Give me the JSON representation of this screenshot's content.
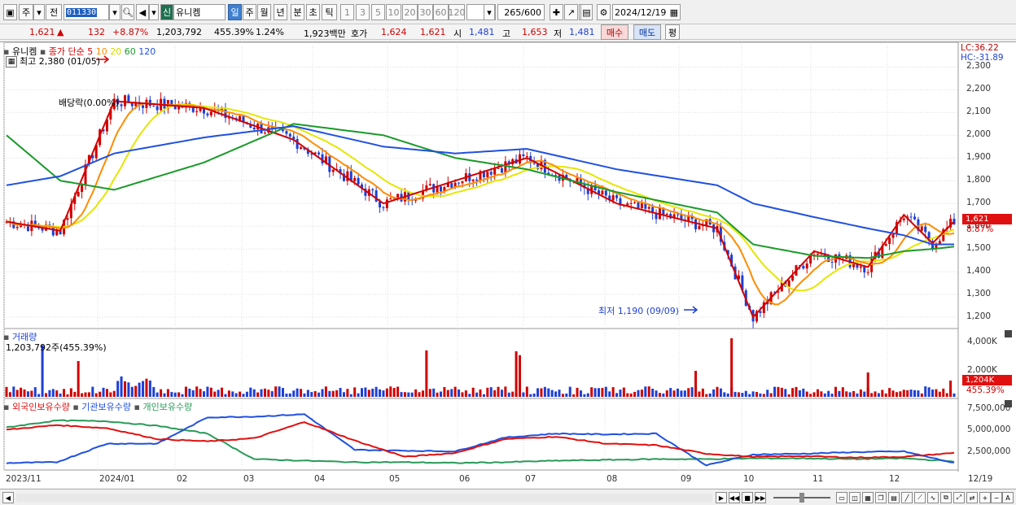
{
  "toolbar": {
    "period_type": "주",
    "prev_label": "전",
    "code": "011330",
    "market_tag": "신",
    "name": "유니켐",
    "periods": [
      "일",
      "주",
      "월",
      "년",
      "분",
      "초",
      "틱"
    ],
    "selected_period": "일",
    "intervals": [
      "1",
      "3",
      "5",
      "10",
      "20",
      "30",
      "60",
      "120"
    ],
    "count_value": "265",
    "count_max": "/600",
    "date": "2024/12/19"
  },
  "info": {
    "price": "1,621",
    "change": "132",
    "change_pct": "+8.87%",
    "volume": "1,203,792",
    "volume_ratio": "455.39%",
    "turnover": "1.24%",
    "amount": "1,923백만",
    "quote_label": "호가",
    "ask": "1,624",
    "bid": "1,621",
    "open_label": "시",
    "open": "1,481",
    "high_label": "고",
    "high": "1,653",
    "low_label": "저",
    "low": "1,481",
    "buy_label": "매수",
    "sell_label": "매도",
    "eval_label": "평"
  },
  "price_panel": {
    "title": "유니켐",
    "ma_label": "종가 단순",
    "ma_periods": [
      "5",
      "10",
      "20",
      "60",
      "120"
    ],
    "lc": "LC:36.22",
    "hc": "HC:-31.89",
    "high_annotation": "최고 2,380 (01/05)",
    "low_annotation": "최저 1,190 (09/09)",
    "dividend_annotation": "배당락(0.00%)",
    "current_price_tag": "1,621",
    "current_pct_tag": "8.87%",
    "yticks": [
      "2,300",
      "2,200",
      "2,100",
      "2,000",
      "1,900",
      "1,800",
      "1,700",
      "1,600",
      "1,500",
      "1,400",
      "1,300",
      "1,200"
    ]
  },
  "volume_panel": {
    "title": "거래량",
    "value_label": "1,203,792주(455.39%)",
    "yticks": [
      "4,000K",
      "2,000K"
    ],
    "current_tag": "1,204K",
    "current_pct": "455.39%"
  },
  "holding_panel": {
    "legend": [
      "외국인보유수량",
      "기관보유수량",
      "개인보유수량"
    ],
    "yticks": [
      "7,500,000",
      "5,000,000",
      "2,500,000"
    ]
  },
  "xaxis": [
    "2023/11",
    "2024/01",
    "02",
    "03",
    "04",
    "05",
    "06",
    "07",
    "08",
    "09",
    "10",
    "11",
    "12",
    "12/19"
  ],
  "colors": {
    "up": "#d10000",
    "down": "#1d3fd6",
    "ma5": "#d10000",
    "ma10": "#ff8c00",
    "ma20": "#e6e600",
    "ma60": "#1a9a2a",
    "ma120": "#2050e0",
    "foreign": "#e01010",
    "institution": "#2050e0",
    "individual": "#2a9a5a"
  },
  "chart_data": {
    "type": "line",
    "ylim": [
      1150,
      2380
    ],
    "x": [
      "2023/11",
      "2024/01",
      "02",
      "03",
      "04",
      "05",
      "06",
      "07",
      "08",
      "09",
      "10",
      "11",
      "12",
      "12/19"
    ],
    "series": [
      {
        "name": "종가 단순 5",
        "values": [
          1620,
          1580,
          2150,
          2120,
          1980,
          1700,
          1800,
          1900,
          1700,
          1590,
          1200,
          1490,
          1420,
          1650,
          1525,
          1621
        ]
      },
      {
        "name": "종가 단순 60",
        "values": [
          2000,
          1800,
          1760,
          1880,
          2050,
          2000,
          1900,
          1850,
          1750,
          1660,
          1520,
          1470,
          1460,
          1490,
          1500,
          1510
        ]
      },
      {
        "name": "종가 단순 120",
        "values": [
          1780,
          1820,
          1920,
          1990,
          2040,
          1950,
          1920,
          1940,
          1850,
          1780,
          1700,
          1640,
          1590,
          1560,
          1520,
          1520
        ]
      }
    ]
  }
}
